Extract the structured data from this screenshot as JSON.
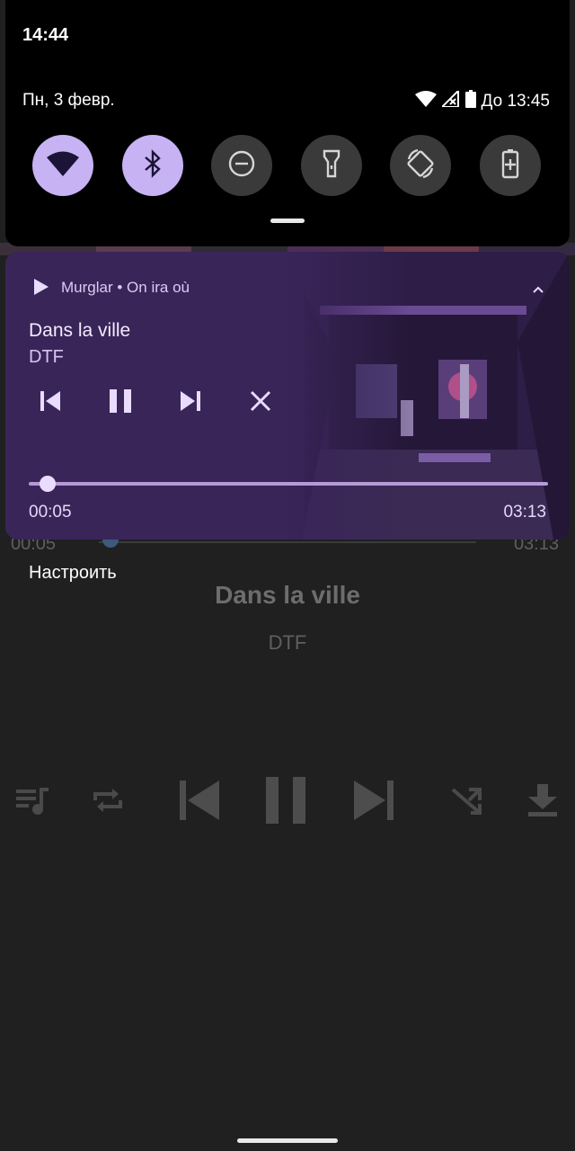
{
  "status_bar": {
    "time": "14:44"
  },
  "quick_settings": {
    "date": "Пн, 3 февр.",
    "battery_text": "До 13:45",
    "tiles": [
      {
        "name": "wifi-tile",
        "icon": "wifi-icon",
        "state": "on"
      },
      {
        "name": "bluetooth-tile",
        "icon": "bluetooth-icon",
        "state": "on"
      },
      {
        "name": "dnd-tile",
        "icon": "do-not-disturb-icon",
        "state": "off"
      },
      {
        "name": "flashlight-tile",
        "icon": "flashlight-icon",
        "state": "off"
      },
      {
        "name": "autorotate-tile",
        "icon": "rotate-icon",
        "state": "off"
      },
      {
        "name": "battery-saver-tile",
        "icon": "battery-saver-icon",
        "state": "off"
      }
    ]
  },
  "media_notification": {
    "app": "Murglar",
    "album": "On ira où",
    "title": "Dans la ville",
    "artist": "DTF",
    "elapsed": "00:05",
    "total": "03:13",
    "progress": 0.026,
    "accent": "#c7b2f3",
    "background": "#3a2559"
  },
  "background_player": {
    "elapsed": "00:05",
    "total": "03:13",
    "customize_label": "Настроить",
    "title": "Dans la ville",
    "artist": "DTF"
  }
}
